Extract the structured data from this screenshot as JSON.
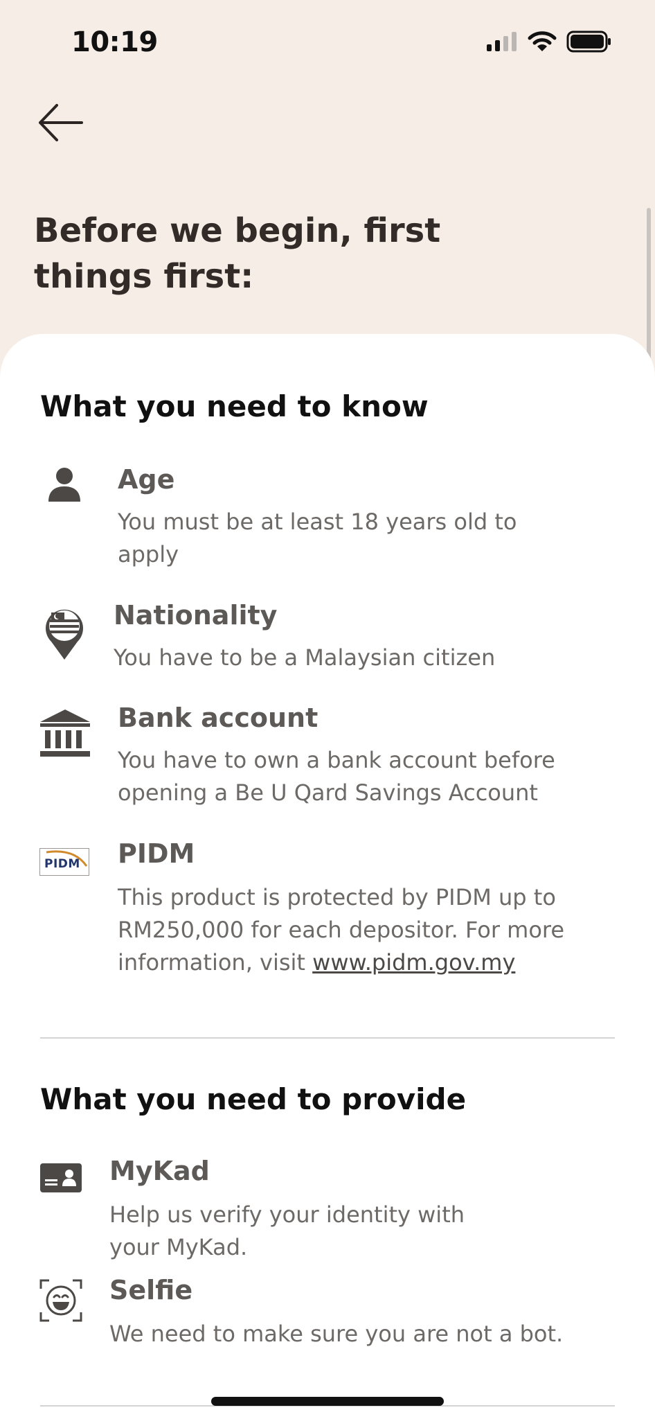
{
  "status_bar": {
    "time": "10:19"
  },
  "header": {
    "title": "Before we begin, first things first:"
  },
  "know_section": {
    "title": "What you need to know",
    "items": [
      {
        "icon": "person-icon",
        "title": "Age",
        "desc": "You must be at least 18 years old to apply"
      },
      {
        "icon": "malaysia-flag-pin-icon",
        "title": "Nationality",
        "desc": "You have to be a Malaysian citizen"
      },
      {
        "icon": "bank-icon",
        "title": "Bank account",
        "desc": "You have to own a bank account before opening a Be U Qard Savings Account"
      },
      {
        "icon": "pidm-logo",
        "title": "PIDM",
        "desc_prefix": "This product is protected by PIDM up to RM250,000 for each depositor. For more information, visit ",
        "link": "www.pidm.gov.my",
        "logo_text": "PIDM"
      }
    ]
  },
  "provide_section": {
    "title": "What you need to provide",
    "items": [
      {
        "icon": "id-card-icon",
        "title": "MyKad",
        "desc": "Help us verify your identity with your MyKad."
      },
      {
        "icon": "selfie-icon",
        "title": "Selfie",
        "desc": "We need to make sure you are not a bot."
      }
    ]
  },
  "colors": {
    "background": "#f5ede6",
    "sheet": "#ffffff",
    "icon": "#4b4846"
  }
}
